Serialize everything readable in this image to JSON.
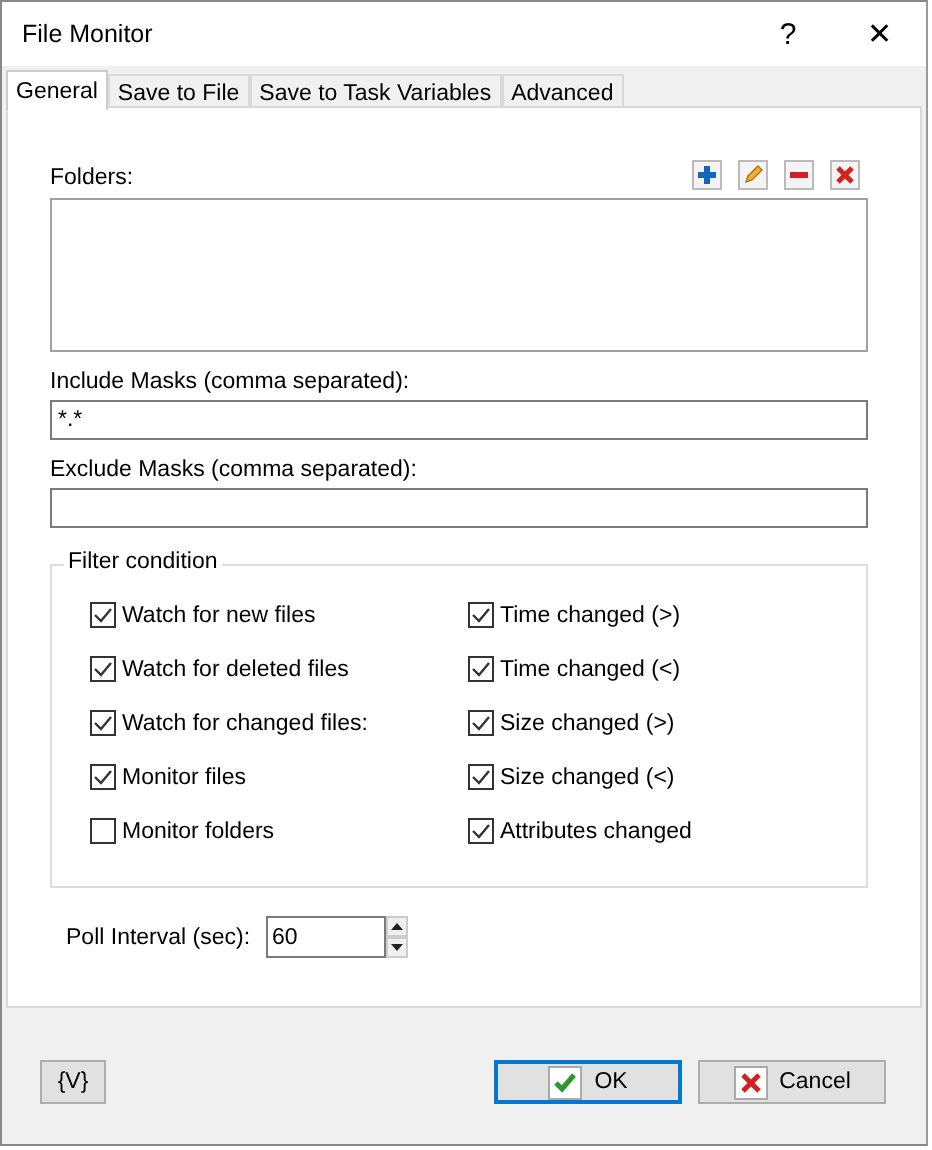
{
  "window": {
    "title": "File Monitor",
    "help": "?",
    "close": "✕"
  },
  "tabs": [
    {
      "label": "General",
      "selected": true
    },
    {
      "label": "Save to File",
      "selected": false
    },
    {
      "label": "Save to Task Variables",
      "selected": false
    },
    {
      "label": "Advanced",
      "selected": false
    }
  ],
  "folders": {
    "label": "Folders:",
    "tools": [
      {
        "kind": "add"
      },
      {
        "kind": "edit"
      },
      {
        "kind": "remove"
      },
      {
        "kind": "clear"
      }
    ]
  },
  "include_masks": {
    "label": "Include Masks (comma separated):",
    "value": "*.*"
  },
  "exclude_masks": {
    "label": "Exclude Masks (comma separated):"
  },
  "filter_condition": {
    "title": "Filter condition",
    "left": [
      {
        "label": "Watch for new files",
        "checked": true
      },
      {
        "label": "Watch for deleted files",
        "checked": true
      },
      {
        "label": "Watch for changed files:",
        "checked": true
      },
      {
        "label": "Monitor files",
        "checked": true
      },
      {
        "label": "Monitor folders",
        "checked": false
      }
    ],
    "right": [
      {
        "label": "Time changed (>)",
        "checked": true
      },
      {
        "label": "Time changed (<)",
        "checked": true
      },
      {
        "label": "Size changed (>)",
        "checked": true
      },
      {
        "label": "Size changed (<)",
        "checked": true
      },
      {
        "label": "Attributes changed",
        "checked": true
      }
    ]
  },
  "poll_interval": {
    "label": "Poll Interval (sec):",
    "value": "60"
  },
  "buttons": {
    "variables": "{V}",
    "ok": "OK",
    "cancel": "Cancel"
  }
}
